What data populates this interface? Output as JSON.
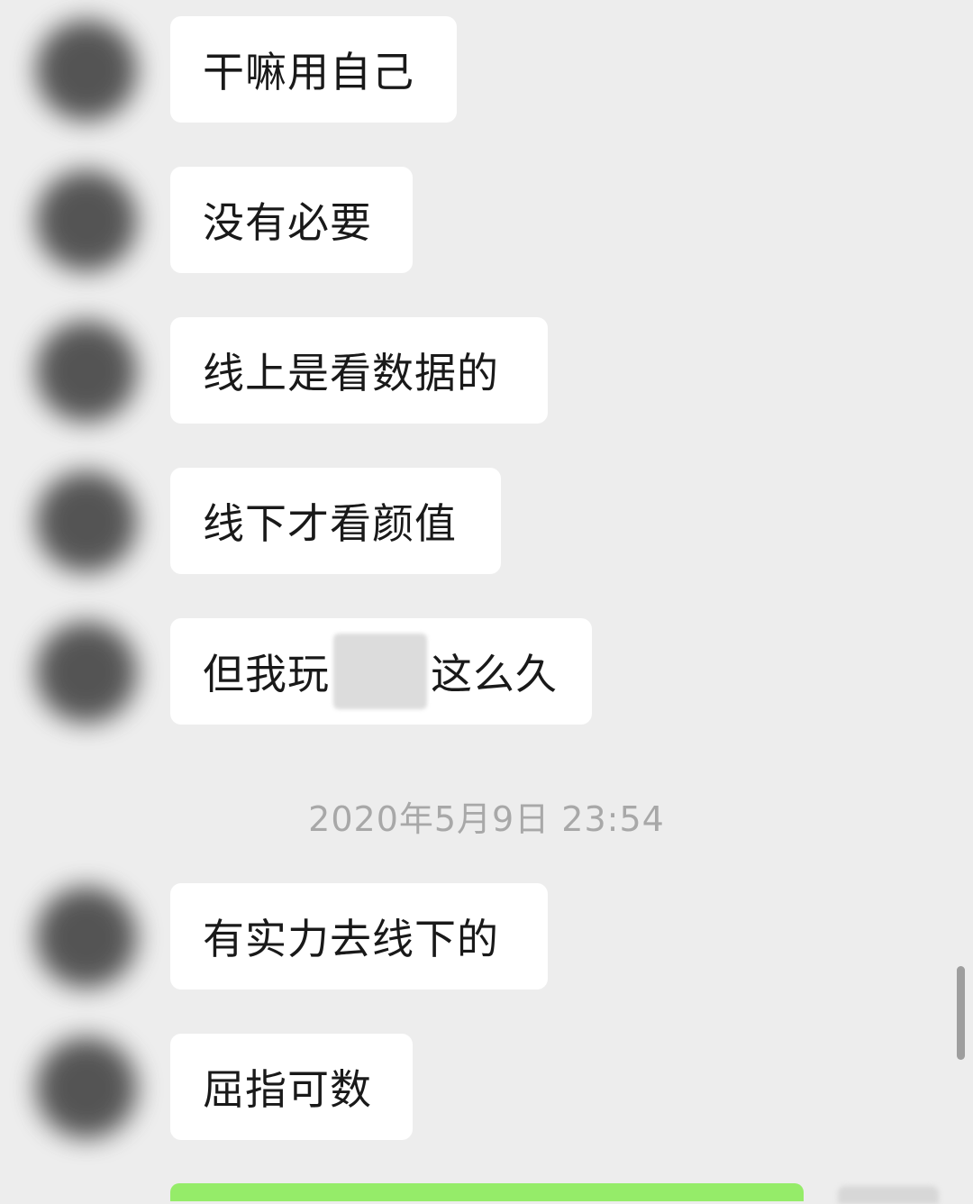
{
  "messages": [
    {
      "text": "干嘛用自己"
    },
    {
      "text": "没有必要"
    },
    {
      "text": "线上是看数据的"
    },
    {
      "text": "线下才看颜值"
    },
    {
      "text_before": "但我玩",
      "text_after": "这么久"
    },
    {
      "text": "有实力去线下的"
    },
    {
      "text": "屈指可数"
    }
  ],
  "timestamp": "2020年5月9日 23:54",
  "colors": {
    "background": "#ededed",
    "bubble_incoming": "#ffffff",
    "bubble_outgoing": "#95ec69",
    "text": "#191919",
    "timestamp": "#a8a8a8"
  }
}
